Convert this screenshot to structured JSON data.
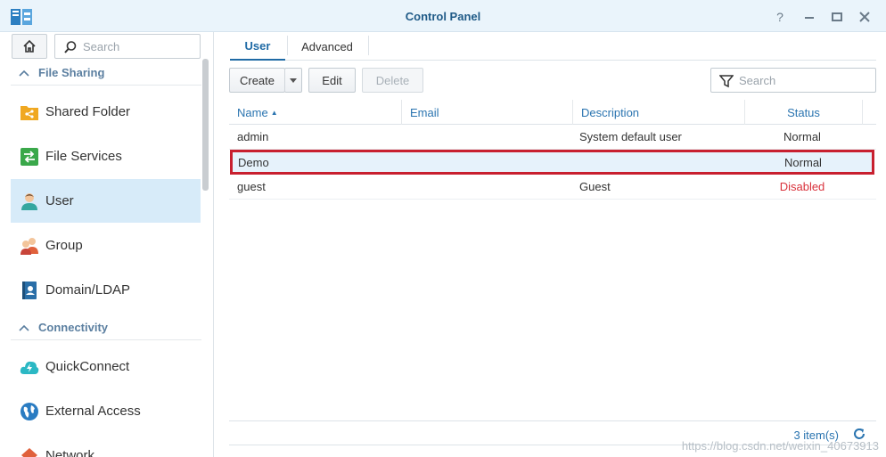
{
  "window": {
    "title": "Control Panel",
    "controls": [
      "help-icon",
      "minimize-icon",
      "maximize-icon",
      "close-icon"
    ]
  },
  "sidebar": {
    "search_placeholder": "Search",
    "sections": [
      {
        "label": "File Sharing",
        "items": [
          {
            "label": "Shared Folder",
            "icon": "shared-folder-icon"
          },
          {
            "label": "File Services",
            "icon": "file-services-icon"
          },
          {
            "label": "User",
            "icon": "user-icon",
            "active": true
          },
          {
            "label": "Group",
            "icon": "group-icon"
          },
          {
            "label": "Domain/LDAP",
            "icon": "domain-ldap-icon"
          }
        ]
      },
      {
        "label": "Connectivity",
        "items": [
          {
            "label": "QuickConnect",
            "icon": "quickconnect-icon"
          },
          {
            "label": "External Access",
            "icon": "external-access-icon"
          },
          {
            "label": "Network",
            "icon": "network-icon"
          }
        ]
      }
    ]
  },
  "main": {
    "tabs": [
      {
        "label": "User",
        "active": true
      },
      {
        "label": "Advanced"
      }
    ],
    "toolbar": {
      "create_label": "Create",
      "edit_label": "Edit",
      "delete_label": "Delete",
      "search_placeholder": "Search"
    },
    "table": {
      "columns": [
        "Name",
        "Email",
        "Description",
        "Status"
      ],
      "sort_indicator": "▲",
      "rows": [
        {
          "name": "admin",
          "email": "",
          "description": "System default user",
          "status": "Normal",
          "status_state": "normal"
        },
        {
          "name": "Demo",
          "email": "",
          "description": "",
          "status": "Normal",
          "status_state": "normal",
          "selected": true
        },
        {
          "name": "guest",
          "email": "",
          "description": "Guest",
          "status": "Disabled",
          "status_state": "disabled"
        }
      ]
    },
    "footer": {
      "count_label": "3 item(s)"
    }
  },
  "watermark": "https://blog.csdn.net/weixin_40673913",
  "colors": {
    "accent": "#1f6aa5",
    "selected_row_bg": "#e6f2fb",
    "highlight_border": "#c8202f",
    "disabled_status": "#d9323c",
    "active_sidebar_bg": "#d7ebf9"
  }
}
